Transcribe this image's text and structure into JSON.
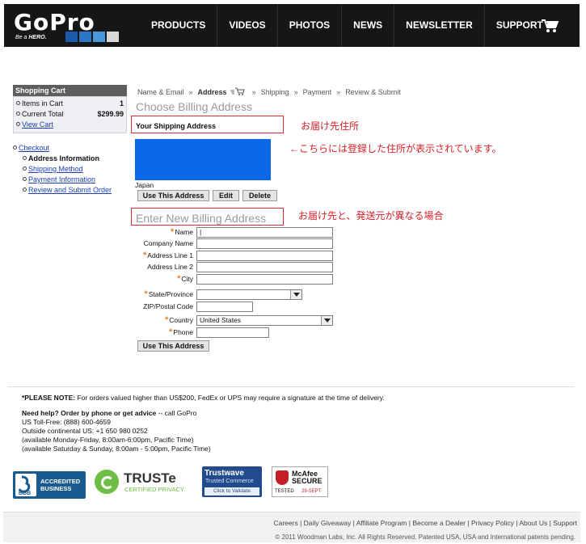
{
  "header": {
    "logo_word": "GoPro",
    "logo_tag_prefix": "Be a ",
    "logo_tag_bold": "HERO.",
    "logo_squares": [
      "#1a5aa8",
      "#2b76c6",
      "#4a98dc",
      "#d8d8d8"
    ],
    "nav": [
      "PRODUCTS",
      "VIDEOS",
      "PHOTOS",
      "NEWS",
      "NEWSLETTER",
      "SUPPORT"
    ],
    "cart_icon": "cart-icon"
  },
  "sidebar": {
    "title": "Shopping Cart",
    "items_in_cart_label": "Items in Cart",
    "items_in_cart_value": "1",
    "current_total_label": "Current Total",
    "current_total_value": "$299.99",
    "view_cart": "View Cart",
    "checkout": "Checkout",
    "steps": [
      "Address Information",
      "Shipping Method",
      "Payment Information",
      "Review and Submit Order"
    ]
  },
  "breadcrumb": [
    "Name & Email",
    "Address",
    "Shipping",
    "Payment",
    "Review & Submit"
  ],
  "billing": {
    "title": "Choose Billing Address",
    "shipping_box_label": "Your Shipping Address",
    "country_line": "Japan",
    "buttons": [
      "Use This Address",
      "Edit",
      "Delete"
    ]
  },
  "annotations": {
    "delivery_address": "お届け先住所",
    "registered_note": "←こちらには登録した住所が表示されています。",
    "different_note": "お届け先と、発送元が異なる場合"
  },
  "new_address": {
    "title": "Enter New Billing Address",
    "fields": [
      {
        "label": "Name",
        "required": true,
        "value": "|"
      },
      {
        "label": "Company Name",
        "required": false,
        "value": ""
      },
      {
        "label": "Address Line 1",
        "required": true,
        "value": ""
      },
      {
        "label": "Address Line 2",
        "required": false,
        "value": ""
      },
      {
        "label": "City",
        "required": true,
        "value": ""
      }
    ],
    "state_label": "State/Province",
    "zip_label": "ZIP/Postal Code",
    "country_label": "Country",
    "country_value": "United States",
    "phone_label": "Phone",
    "submit": "Use This Address"
  },
  "notes": {
    "note_bold": "*PLEASE NOTE:",
    "note_text": " For orders valued higher than US$200, FedEx or UPS may require a signature at the time of delivery.",
    "help_bold": "Need help? Order by phone or get advice",
    "help_text": " -- call GoPro",
    "lines": [
      "US Toll-Free: (888) 600-4659",
      "Outside continental US: +1 650 980 0252",
      "(available Monday-Friday, 8:00am-6:00pm, Pacific Time)",
      "(available Saturday & Sunday, 8:00am - 5:00pm, Pacific Time)"
    ]
  },
  "badges": {
    "bbb": [
      "ACCREDITED",
      "BUSINESS"
    ],
    "bbb_logo": "BBB",
    "truste": "TRUSTe",
    "truste_sub": "CERTIFIED PRIVACY",
    "trustwave": "Trustwave",
    "trustwave_sub": "Trusted Commerce",
    "trustwave_cta": "Click to Validate",
    "mcafee": "McAfee",
    "mcafee_secure": "SECURE",
    "mcafee_tested": "TESTED",
    "mcafee_date": "29-SEPT"
  },
  "footer": {
    "links": [
      "Careers",
      "Daily Giveaway",
      "Affiliate Program",
      "Become a Dealer",
      "Privacy Policy",
      "About Us",
      "Support"
    ],
    "copyright": "© 2011 Woodman Labs, Inc. All Rights Reserved. Patented USA, USA and International patents pending."
  }
}
